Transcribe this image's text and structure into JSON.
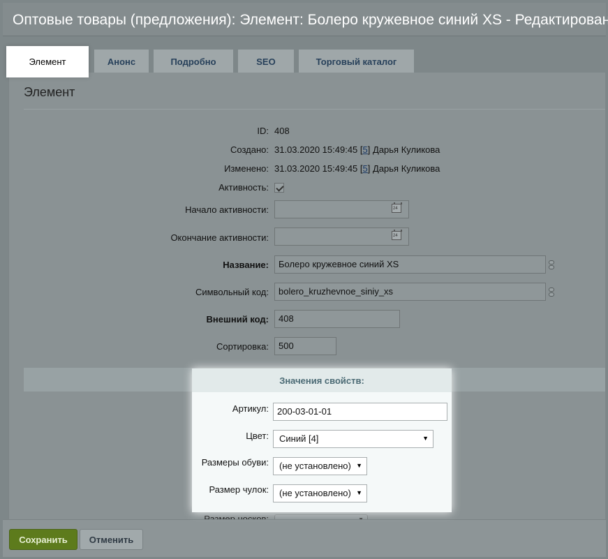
{
  "window_title": "Оптовые товары (предложения): Элемент: Болеро кружевное синий XS - Редактирование",
  "tabs": [
    {
      "label": "Элемент",
      "active": true
    },
    {
      "label": "Анонс"
    },
    {
      "label": "Подробно"
    },
    {
      "label": "SEO"
    },
    {
      "label": "Торговый каталог"
    }
  ],
  "section_title": "Элемент",
  "fields": {
    "id": {
      "label": "ID:",
      "value": "408"
    },
    "created": {
      "label": "Создано:",
      "datetime": "31.03.2020 15:49:45",
      "link_open": "[",
      "user_id": "5",
      "link_close": "]",
      "user": "Дарья Куликова"
    },
    "modified": {
      "label": "Изменено:",
      "datetime": "31.03.2020 15:49:45",
      "link_open": "[",
      "user_id": "5",
      "link_close": "]",
      "user": "Дарья Куликова"
    },
    "active": {
      "label": "Активность:",
      "checked": true
    },
    "active_from": {
      "label": "Начало активности:",
      "value": ""
    },
    "active_to": {
      "label": "Окончание активности:",
      "value": ""
    },
    "name": {
      "label": "Название:",
      "value": "Болеро кружевное синий XS"
    },
    "code": {
      "label": "Символьный код:",
      "value": "bolero_kruzhevnoe_siniy_xs"
    },
    "external_code": {
      "label": "Внешний код:",
      "value": "408"
    },
    "sort": {
      "label": "Сортировка:",
      "value": "500"
    }
  },
  "properties": {
    "header": "Значения свойств:",
    "article": {
      "label": "Артикул:",
      "value": "200-03-01-01"
    },
    "color": {
      "label": "Цвет:",
      "value": "Синий [4]"
    },
    "shoe_size": {
      "label": "Размеры обуви:",
      "value": "(не установлено)"
    },
    "stocking_size": {
      "label": "Размер чулок:",
      "value": "(не установлено)"
    },
    "sock_size": {
      "label": "Размер носков:"
    }
  },
  "buttons": {
    "save": "Сохранить",
    "cancel": "Отменить"
  },
  "colors": {
    "save_button": "#5d7b1c",
    "highlight": "#f5f9f9",
    "dim_overlay": "#7e8789"
  }
}
